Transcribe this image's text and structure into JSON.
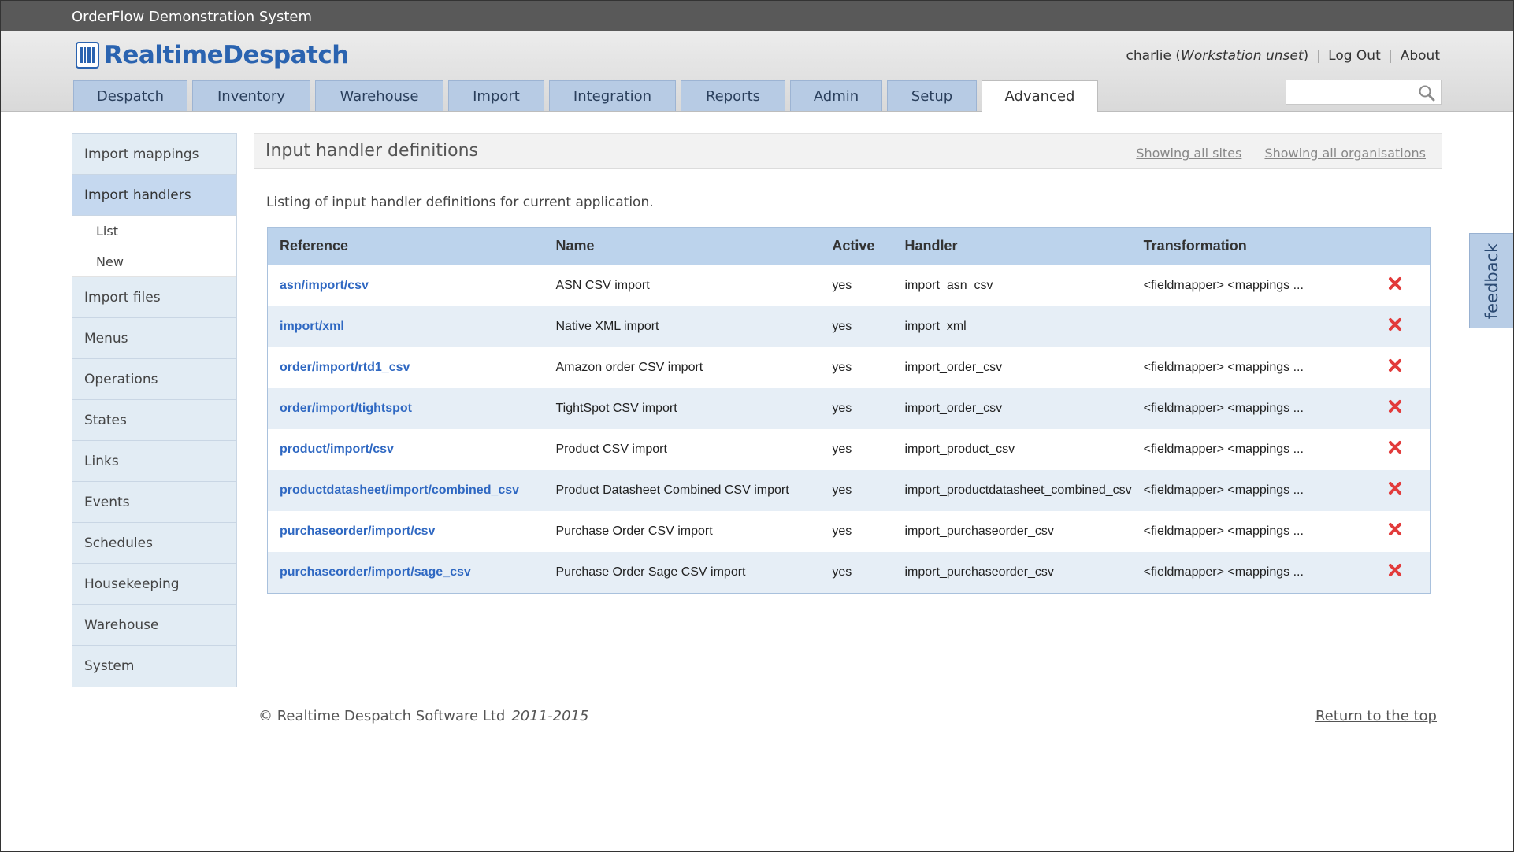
{
  "app": {
    "system_title": "OrderFlow Demonstration System",
    "logo_text": "RealtimeDespatch"
  },
  "user": {
    "name": "charlie",
    "workstation": "Workstation unset",
    "logout": "Log Out",
    "about": "About"
  },
  "tabs": [
    {
      "label": "Despatch",
      "active": false
    },
    {
      "label": "Inventory",
      "active": false
    },
    {
      "label": "Warehouse",
      "active": false
    },
    {
      "label": "Import",
      "active": false
    },
    {
      "label": "Integration",
      "active": false
    },
    {
      "label": "Reports",
      "active": false
    },
    {
      "label": "Admin",
      "active": false
    },
    {
      "label": "Setup",
      "active": false
    },
    {
      "label": "Advanced",
      "active": true
    }
  ],
  "search": {
    "placeholder": ""
  },
  "sidebar": {
    "items": [
      {
        "label": "Import mappings"
      },
      {
        "label": "Import handlers",
        "active": true
      },
      {
        "label": "List",
        "sub": true
      },
      {
        "label": "New",
        "sub": true
      },
      {
        "label": "Import files"
      },
      {
        "label": "Menus"
      },
      {
        "label": "Operations"
      },
      {
        "label": "States"
      },
      {
        "label": "Links"
      },
      {
        "label": "Events"
      },
      {
        "label": "Schedules"
      },
      {
        "label": "Housekeeping"
      },
      {
        "label": "Warehouse"
      },
      {
        "label": "System"
      }
    ]
  },
  "main": {
    "title": "Input handler definitions",
    "sites_link": "Showing all sites",
    "orgs_link": "Showing all organisations",
    "intro": "Listing of input handler definitions for current application.",
    "columns": [
      "Reference",
      "Name",
      "Active",
      "Handler",
      "Transformation"
    ],
    "rows": [
      {
        "reference": "asn/import/csv",
        "name": "ASN CSV import",
        "active": "yes",
        "handler": "import_asn_csv",
        "transformation": "<fieldmapper> <mappings ..."
      },
      {
        "reference": "import/xml",
        "name": "Native XML import",
        "active": "yes",
        "handler": "import_xml",
        "transformation": ""
      },
      {
        "reference": "order/import/rtd1_csv",
        "name": "Amazon order CSV import",
        "active": "yes",
        "handler": "import_order_csv",
        "transformation": "<fieldmapper> <mappings ..."
      },
      {
        "reference": "order/import/tightspot",
        "name": "TightSpot CSV import",
        "active": "yes",
        "handler": "import_order_csv",
        "transformation": "<fieldmapper> <mappings ..."
      },
      {
        "reference": "product/import/csv",
        "name": "Product CSV import",
        "active": "yes",
        "handler": "import_product_csv",
        "transformation": "<fieldmapper> <mappings ..."
      },
      {
        "reference": "productdatasheet/import/combined_csv",
        "name": "Product Datasheet Combined CSV import",
        "active": "yes",
        "handler": "import_productdatasheet_combined_csv",
        "transformation": "<fieldmapper> <mappings ..."
      },
      {
        "reference": "purchaseorder/import/csv",
        "name": "Purchase Order CSV import",
        "active": "yes",
        "handler": "import_purchaseorder_csv",
        "transformation": "<fieldmapper> <mappings ..."
      },
      {
        "reference": "purchaseorder/import/sage_csv",
        "name": "Purchase Order Sage CSV import",
        "active": "yes",
        "handler": "import_purchaseorder_csv",
        "transformation": "<fieldmapper> <mappings ..."
      }
    ]
  },
  "footer": {
    "copyright": "© Realtime Despatch Software Ltd",
    "years": "2011-2015",
    "return_top": "Return to the top"
  },
  "feedback": {
    "label": "feedback"
  },
  "icons": {
    "delete": "delete-x-icon",
    "search": "search-icon",
    "logo": "barcode-logo-icon"
  },
  "colors": {
    "accent": "#2a63b0",
    "tab": "#b7cbe4",
    "delete": "#e23b3b",
    "header_row": "#bcd3ec"
  }
}
